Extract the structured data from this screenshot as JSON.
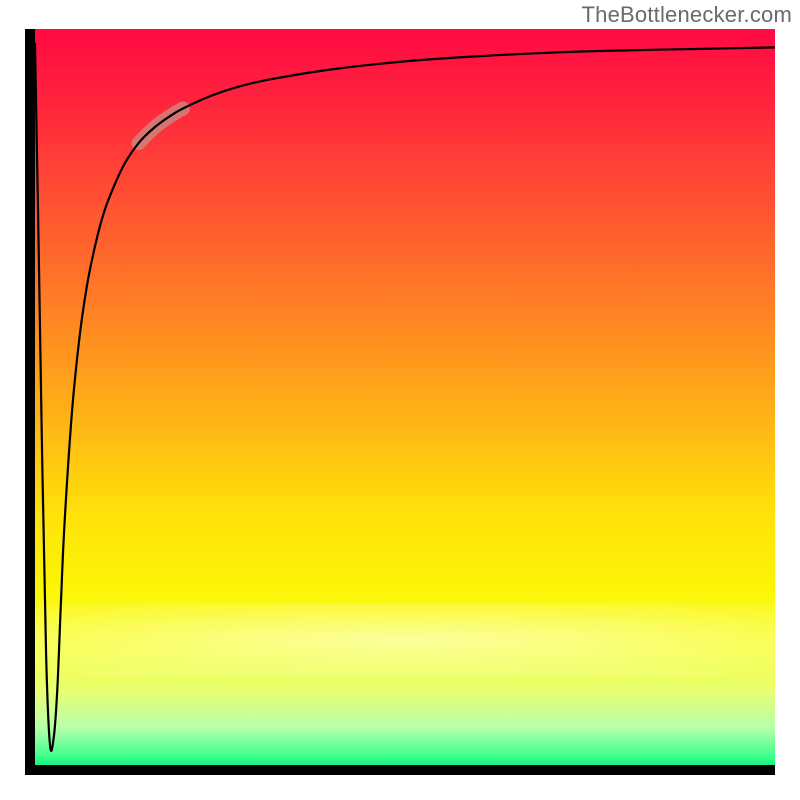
{
  "watermark": "TheBottlenecker.com",
  "colors": {
    "axis": "#000000",
    "curve": "#000000",
    "highlight": "#c98b82"
  },
  "chart_data": {
    "type": "line",
    "title": "",
    "xlabel": "",
    "ylabel": "",
    "xlim": [
      0,
      100
    ],
    "ylim": [
      0,
      100
    ],
    "x": [
      0.0,
      0.5,
      1.0,
      1.5,
      2.0,
      2.5,
      3.0,
      3.5,
      4.0,
      5.0,
      6.0,
      7.0,
      8.0,
      9.0,
      10.0,
      12.0,
      14.0,
      16.0,
      18.0,
      20.0,
      24.0,
      28.0,
      32.0,
      40.0,
      50.0,
      60.0,
      70.0,
      80.0,
      90.0,
      100.0
    ],
    "values": [
      98.0,
      70.0,
      40.0,
      15.0,
      3.0,
      3.5,
      10.0,
      22.0,
      33.0,
      48.0,
      58.0,
      65.0,
      70.0,
      74.0,
      77.0,
      81.5,
      84.5,
      86.5,
      88.0,
      89.2,
      91.0,
      92.3,
      93.2,
      94.5,
      95.6,
      96.3,
      96.8,
      97.1,
      97.3,
      97.5
    ],
    "highlight_segment": {
      "x_start": 14.0,
      "x_end": 22.0
    },
    "grid": false,
    "legend": false
  }
}
